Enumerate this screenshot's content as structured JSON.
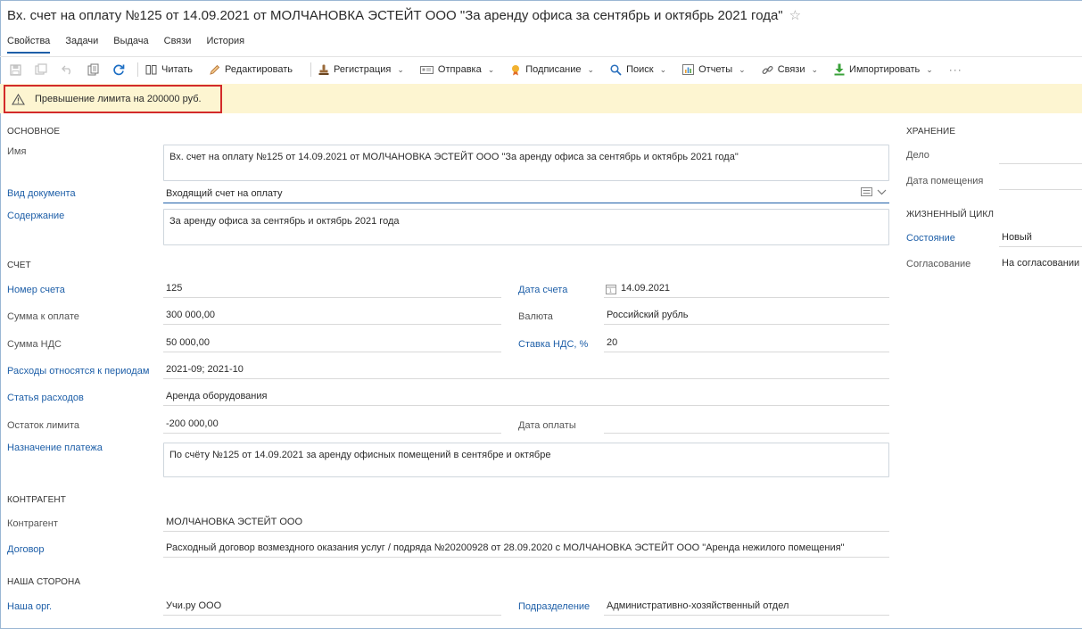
{
  "header": {
    "title": "Вх. счет на оплату №125 от 14.09.2021 от МОЛЧАНОВКА ЭСТЕЙТ ООО \"За аренду офиса за сентябрь и октябрь 2021 года\""
  },
  "tabs": [
    {
      "label": "Свойства",
      "active": true
    },
    {
      "label": "Задачи"
    },
    {
      "label": "Выдача"
    },
    {
      "label": "Связи"
    },
    {
      "label": "История"
    }
  ],
  "toolbar": {
    "icons": [
      "save-icon",
      "save-and-close-icon",
      "undo-icon",
      "copy-icon",
      "refresh-icon"
    ],
    "buttons": [
      {
        "label": "Читать",
        "icon": "book-icon",
        "dropdown": false
      },
      {
        "label": "Редактировать",
        "icon": "pencil-icon",
        "dropdown": false
      },
      {
        "label": "Регистрация",
        "icon": "stamp-icon",
        "dropdown": true
      },
      {
        "label": "Отправка",
        "icon": "send-icon",
        "dropdown": true
      },
      {
        "label": "Подписание",
        "icon": "signature-icon",
        "dropdown": true
      },
      {
        "label": "Поиск",
        "icon": "search-icon",
        "dropdown": true
      },
      {
        "label": "Отчеты",
        "icon": "report-icon",
        "dropdown": true
      },
      {
        "label": "Связи",
        "icon": "link-icon",
        "dropdown": true
      },
      {
        "label": "Импортировать",
        "icon": "import-icon",
        "dropdown": true
      }
    ],
    "more": "···"
  },
  "warning": {
    "text": "Превышение лимита на 200000 руб."
  },
  "main": {
    "section_main": "ОСНОВНОЕ",
    "name_label": "Имя",
    "name_value": "Вх. счет на оплату №125 от 14.09.2021 от МОЛЧАНОВКА ЭСТЕЙТ ООО \"За аренду офиса за сентябрь и октябрь 2021 года\"",
    "doc_type_label": "Вид документа",
    "doc_type_value": "Входящий счет на оплату",
    "content_label": "Содержание",
    "content_value": "За аренду офиса за сентябрь и октябрь 2021 года",
    "section_invoice": "СЧЕТ",
    "invoice_no_label": "Номер счета",
    "invoice_no_value": "125",
    "invoice_date_label": "Дата счета",
    "invoice_date_value": "14.09.2021",
    "amount_label": "Сумма к оплате",
    "amount_value": "300 000,00",
    "currency_label": "Валюта",
    "currency_value": "Российский рубль",
    "vat_amount_label": "Сумма НДС",
    "vat_amount_value": "50 000,00",
    "vat_rate_label": "Ставка НДС, %",
    "vat_rate_value": "20",
    "periods_label": "Расходы относятся к периодам",
    "periods_value": "2021-09; 2021-10",
    "expense_item_label": "Статья расходов",
    "expense_item_value": "Аренда оборудования",
    "limit_rest_label": "Остаток лимита",
    "limit_rest_value": "-200 000,00",
    "payment_date_label": "Дата оплаты",
    "payment_date_value": "",
    "purpose_label": "Назначение платежа",
    "purpose_value": "По счёту №125 от 14.09.2021 за аренду офисных помещений в сентябре и октябре",
    "section_counterparty": "КОНТРАГЕНТ",
    "counterparty_label": "Контрагент",
    "counterparty_value": "МОЛЧАНОВКА ЭСТЕЙТ ООО",
    "contract_label": "Договор",
    "contract_value": "Расходный договор возмездного оказания услуг / подряда №20200928 от 28.09.2020 с МОЛЧАНОВКА ЭСТЕЙТ ООО \"Аренда нежилого помещения\"",
    "section_our_side": "НАША СТОРОНА",
    "our_org_label": "Наша орг.",
    "our_org_value": "Учи.ру ООО",
    "department_label": "Подразделение",
    "department_value": "Административно-хозяйственный отдел"
  },
  "right": {
    "section_storage": "ХРАНЕНИЕ",
    "case_label": "Дело",
    "case_value": "",
    "placed_date_label": "Дата помещения",
    "placed_date_value": "",
    "section_lifecycle": "ЖИЗНЕННЫЙ ЦИКЛ",
    "state_label": "Состояние",
    "state_value": "Новый",
    "approval_label": "Согласование",
    "approval_value": "На согласовании"
  },
  "colors": {
    "accent": "#1e5fa8",
    "warning_bg": "#fdf5d1",
    "highlight": "#d32a2a"
  }
}
